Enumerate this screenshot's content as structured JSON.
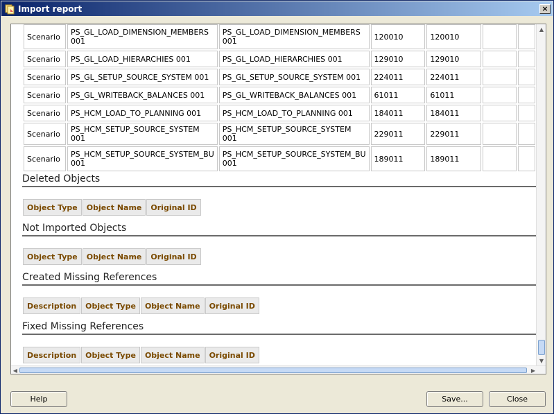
{
  "window": {
    "title": "Import report",
    "close_glyph": "×"
  },
  "objects_table": {
    "rows": [
      {
        "type": "Scenario",
        "name_line1": "PS_GL_LOAD_DIMENSION_MEMBERS",
        "name_line2": "001",
        "orig_line1": "PS_GL_LOAD_DIMENSION_MEMBERS",
        "orig_line2": "001",
        "id1": "120010",
        "id2": "120010"
      },
      {
        "type": "Scenario",
        "name_line1": "PS_GL_LOAD_HIERARCHIES 001",
        "name_line2": "",
        "orig_line1": "PS_GL_LOAD_HIERARCHIES 001",
        "orig_line2": "",
        "id1": "129010",
        "id2": "129010"
      },
      {
        "type": "Scenario",
        "name_line1": "PS_GL_SETUP_SOURCE_SYSTEM 001",
        "name_line2": "",
        "orig_line1": "PS_GL_SETUP_SOURCE_SYSTEM 001",
        "orig_line2": "",
        "id1": "224011",
        "id2": "224011"
      },
      {
        "type": "Scenario",
        "name_line1": "PS_GL_WRITEBACK_BALANCES 001",
        "name_line2": "",
        "orig_line1": "PS_GL_WRITEBACK_BALANCES 001",
        "orig_line2": "",
        "id1": "61011",
        "id2": "61011"
      },
      {
        "type": "Scenario",
        "name_line1": "PS_HCM_LOAD_TO_PLANNING 001",
        "name_line2": "",
        "orig_line1": "PS_HCM_LOAD_TO_PLANNING 001",
        "orig_line2": "",
        "id1": "184011",
        "id2": "184011"
      },
      {
        "type": "Scenario",
        "name_line1": "PS_HCM_SETUP_SOURCE_SYSTEM 001",
        "name_line2": "",
        "orig_line1": "PS_HCM_SETUP_SOURCE_SYSTEM 001",
        "orig_line2": "",
        "id1": "229011",
        "id2": "229011"
      },
      {
        "type": "Scenario",
        "name_line1": "PS_HCM_SETUP_SOURCE_SYSTEM_BU",
        "name_line2": "001",
        "orig_line1": "PS_HCM_SETUP_SOURCE_SYSTEM_BU",
        "orig_line2": "001",
        "id1": "189011",
        "id2": "189011"
      }
    ]
  },
  "sections": {
    "deleted": {
      "heading": "Deleted Objects",
      "columns": [
        "Object Type",
        "Object Name",
        "Original ID"
      ]
    },
    "not_imported": {
      "heading": "Not Imported Objects",
      "columns": [
        "Object Type",
        "Object Name",
        "Original ID"
      ]
    },
    "created_missing": {
      "heading": "Created Missing References",
      "columns": [
        "Description",
        "Object Type",
        "Object Name",
        "Original ID"
      ]
    },
    "fixed_missing": {
      "heading": "Fixed Missing References",
      "columns": [
        "Description",
        "Object Type",
        "Object Name",
        "Original ID"
      ]
    }
  },
  "buttons": {
    "help": "Help",
    "save": "Save...",
    "close": "Close"
  },
  "colors": {
    "title_bar_start": "#0a246a",
    "title_bar_end": "#a6caf0",
    "header_text": "#7a4a00",
    "header_bg": "#eaeaea"
  }
}
